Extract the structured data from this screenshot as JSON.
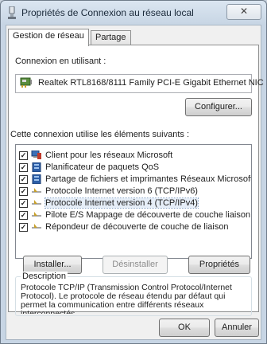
{
  "window": {
    "title": "Propriétés de Connexion au réseau local",
    "close_glyph": "✕"
  },
  "tabs": [
    {
      "label": "Gestion de réseau",
      "active": true
    },
    {
      "label": "Partage",
      "active": false
    }
  ],
  "connection": {
    "label": "Connexion en utilisant :",
    "adapter": "Realtek RTL8168/8111 Family PCI-E Gigabit Ethernet NIC",
    "configure_button": "Configurer..."
  },
  "components": {
    "label": "Cette connexion utilise les éléments suivants :",
    "items": [
      {
        "label": "Client pour les réseaux Microsoft",
        "checked": true,
        "icon": "network-client-icon"
      },
      {
        "label": "Planificateur de paquets QoS",
        "checked": true,
        "icon": "service-icon"
      },
      {
        "label": "Partage de fichiers et imprimantes Réseaux Microsoft",
        "checked": true,
        "icon": "service-icon"
      },
      {
        "label": "Protocole Internet version 6 (TCP/IPv6)",
        "checked": true,
        "icon": "protocol-icon"
      },
      {
        "label": "Protocole Internet version 4 (TCP/IPv4)",
        "checked": true,
        "icon": "protocol-icon",
        "selected": true
      },
      {
        "label": "Pilote E/S Mappage de découverte de couche liaison",
        "checked": true,
        "icon": "protocol-icon"
      },
      {
        "label": "Répondeur de découverte de couche de liaison",
        "checked": true,
        "icon": "protocol-icon"
      }
    ]
  },
  "actions": {
    "install": "Installer...",
    "uninstall": "Désinstaller",
    "properties": "Propriétés"
  },
  "description": {
    "label": "Description",
    "text": "Protocole TCP/IP (Transmission Control Protocol/Internet Protocol). Le protocole de réseau étendu par défaut qui permet la communication entre différents réseaux interconnectés."
  },
  "footer": {
    "ok": "OK",
    "cancel": "Annuler"
  },
  "colors": {
    "selection": "#e6eef8",
    "protocol_icon": "#c8a02a",
    "service_icon": "#2d5fa8"
  }
}
